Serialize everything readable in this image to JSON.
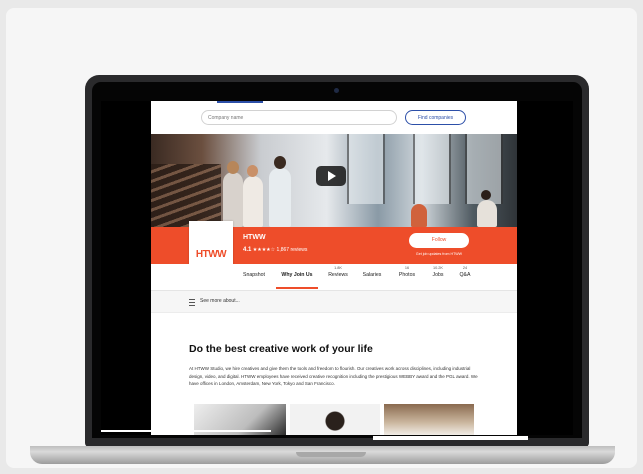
{
  "topbar": {
    "search_placeholder": "Company name",
    "find_button": "Find companies"
  },
  "company": {
    "logo_text": "HTWW",
    "name": "HTWW",
    "rating": "4.1",
    "stars": "★★★★☆",
    "stars_value": 4.1,
    "reviews": "1,867 reviews",
    "follow_button": "Follow",
    "follow_note": "Get job updates from HTWW"
  },
  "tabs": [
    {
      "label": "Snapshot",
      "count": ""
    },
    {
      "label": "Why Join Us",
      "count": ""
    },
    {
      "label": "Reviews",
      "count": "1.8K"
    },
    {
      "label": "Salaries",
      "count": ""
    },
    {
      "label": "Photos",
      "count": "16"
    },
    {
      "label": "Jobs",
      "count": "10.2K"
    },
    {
      "label": "Q&A",
      "count": "24"
    }
  ],
  "see_more": "See more about...",
  "main": {
    "headline": "Do the best creative work of your life",
    "body": "At HTWW Studio, we hire creatives and give them the tools and freedom to flourish. Our creatives work across disciplines, including industrial design, video, and digital. HTWW employees have received creative recognition including the prestigious WEBBY award and the PGL award. We have offices in London, Amsterdam, New York, Tokyo and San Francisco."
  },
  "colors": {
    "brand": "#ee4d2a",
    "link": "#2c4fa8"
  },
  "icons": {
    "play": "play-icon",
    "menu": "hamburger-icon",
    "camera": "camera-icon"
  }
}
